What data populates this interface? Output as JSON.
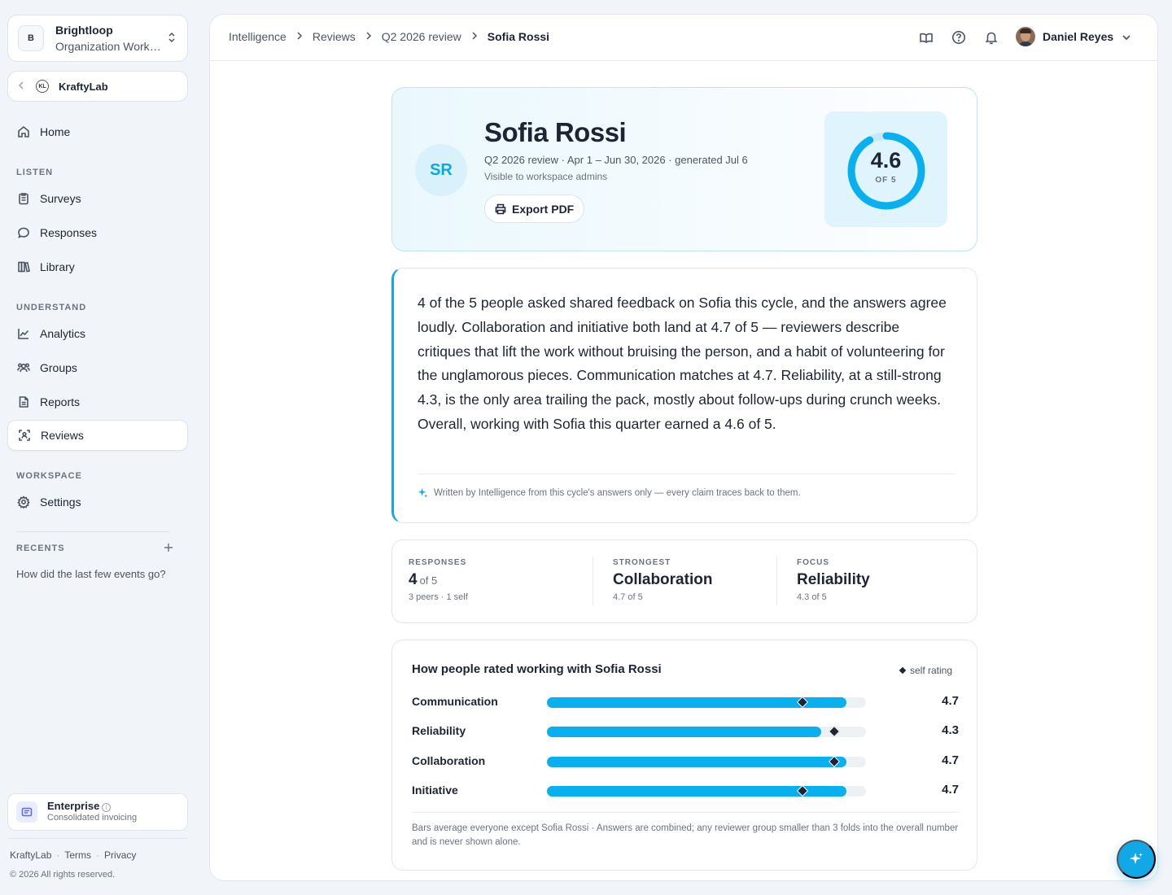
{
  "org": {
    "badge": "B",
    "name": "Brightloop",
    "subtitle": "Organization Workspace"
  },
  "team": {
    "logo": "KL",
    "name": "KraftyLab"
  },
  "nav": {
    "home": "Home",
    "listen_label": "LISTEN",
    "surveys": "Surveys",
    "responses": "Responses",
    "library": "Library",
    "understand_label": "UNDERSTAND",
    "analytics": "Analytics",
    "groups": "Groups",
    "reports": "Reports",
    "reviews": "Reviews",
    "workspace_label": "WORKSPACE",
    "settings": "Settings",
    "recents_label": "RECENTS",
    "recent_item": "How did the last few events go?"
  },
  "plan": {
    "title": "Enterprise",
    "subtitle": "Consolidated invoicing"
  },
  "footer": {
    "brand": "KraftyLab",
    "terms": "Terms",
    "privacy": "Privacy",
    "copyright": "© 2026 All rights reserved."
  },
  "breadcrumbs": [
    "Intelligence",
    "Reviews",
    "Q2 2026 review",
    "Sofia Rossi"
  ],
  "user": {
    "name": "Daniel Reyes"
  },
  "hero": {
    "initials": "SR",
    "name": "Sofia Rossi",
    "meta": "Q2 2026 review · Apr 1 – Jun 30, 2026 · generated Jul 6",
    "visibility": "Visible to workspace admins",
    "export_label": "Export PDF",
    "score": "4.6",
    "score_of": "OF 5",
    "score_fraction": 0.92
  },
  "summary": {
    "text": "4 of the 5 people asked shared feedback on Sofia this cycle, and the answers agree loudly. Collaboration and initiative both land at 4.7 of 5 — reviewers describe critiques that lift the work without bruising the person, and a habit of volunteering for the unglamorous pieces. Communication matches at 4.7. Reliability, at a still-strong 4.3, is the only area trailing the pack, mostly about follow-ups during crunch weeks. Overall, working with Sofia this quarter earned a 4.6 of 5.",
    "note": "Written by Intelligence from this cycle's answers only — every claim traces back to them."
  },
  "stats": {
    "responses_label": "RESPONSES",
    "responses_value": "4",
    "responses_of": "of 5",
    "responses_sub": "3 peers · 1 self",
    "strongest_label": "STRONGEST",
    "strongest_value": "Collaboration",
    "strongest_sub": "4.7 of 5",
    "focus_label": "FOCUS",
    "focus_value": "Reliability",
    "focus_sub": "4.3 of 5"
  },
  "ratings": {
    "title": "How people rated working with Sofia Rossi",
    "legend": "self rating",
    "note": "Bars average everyone except Sofia Rossi · Answers are combined; any reviewer group smaller than 3 folds into the overall number and is never shown alone.",
    "rows": [
      {
        "label": "Communication",
        "value": "4.7",
        "avg": 4.7,
        "self": 4.0
      },
      {
        "label": "Reliability",
        "value": "4.3",
        "avg": 4.3,
        "self": 4.5
      },
      {
        "label": "Collaboration",
        "value": "4.7",
        "avg": 4.7,
        "self": 4.5
      },
      {
        "label": "Initiative",
        "value": "4.7",
        "avg": 4.7,
        "self": 4.0
      }
    ],
    "scale_max": 5
  }
}
